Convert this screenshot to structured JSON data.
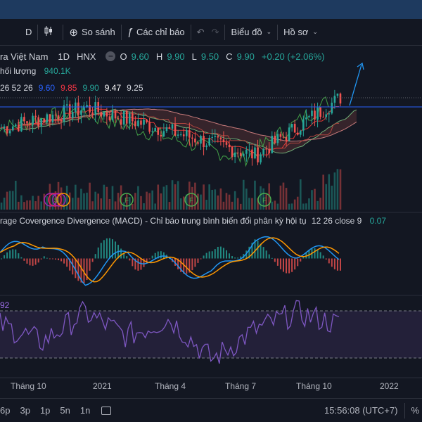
{
  "toolbar": {
    "interval": "D",
    "compare_label": "So sánh",
    "indicators_label": "Các chỉ báo",
    "chart_type_label": "Biểu đồ",
    "profile_label": "Hồ sơ"
  },
  "symbol": {
    "name": "ra Việt Nam",
    "interval": "1D",
    "exchange": "HNX",
    "o_label": "O",
    "o_value": "9.60",
    "h_label": "H",
    "h_value": "9.90",
    "l_label": "L",
    "l_value": "9.50",
    "c_label": "C",
    "c_value": "9.90",
    "change": "+0.20 (+2.06%)"
  },
  "volume": {
    "label": "hối lượng",
    "value": "940.1K"
  },
  "indicator_values": [
    {
      "text": "26 52 26",
      "color": "#d1d4dc"
    },
    {
      "text": "9.60",
      "color": "#2962ff"
    },
    {
      "text": "9.85",
      "color": "#f23645"
    },
    {
      "text": "9.90",
      "color": "#26a69a"
    },
    {
      "text": "9.47",
      "color": "#ffffff"
    },
    {
      "text": "9.25",
      "color": "#d1d4dc"
    }
  ],
  "macd": {
    "title": "rage Covergence Divergence (MACD) - Chỉ báo trung bình biến đổi phân kỳ hội tụ",
    "params": "12 26 close 9",
    "value": "0.07"
  },
  "rsi": {
    "value": "92"
  },
  "time_axis": [
    {
      "label": "Tháng 10",
      "x": 15
    },
    {
      "label": "2021",
      "x": 132
    },
    {
      "label": "Tháng 4",
      "x": 220
    },
    {
      "label": "Tháng 7",
      "x": 320
    },
    {
      "label": "Tháng 10",
      "x": 421
    },
    {
      "label": "2022",
      "x": 540
    }
  ],
  "bottombar": {
    "ranges": [
      "6p",
      "3p",
      "1p",
      "5n",
      "1n"
    ],
    "clock": "15:56:08 (UTC+7)"
  },
  "colors": {
    "background": "#131722",
    "up": "#26a69a",
    "down": "#ef5350",
    "macd_line": "#2196f3",
    "signal_line": "#ff9800",
    "rsi_line": "#7e57c2",
    "price_line": "#2962ff"
  },
  "chart_data": [
    {
      "type": "line",
      "title": "",
      "x": [
        "Tháng 10",
        "2021",
        "Tháng 4",
        "Tháng 7",
        "Tháng 10"
      ],
      "series": [
        {
          "name": "",
          "values": [
            9.0,
            9.6,
            8.9,
            8.2,
            9.9
          ]
        }
      ],
      "last_price": 9.9
    },
    {
      "type": "line",
      "series": [
        {
          "name": "",
          "values": [
            0.1,
            0.3,
            -0.35,
            0.1,
            -0.1,
            -0.3,
            0.3,
            0.12,
            0.07
          ]
        }
      ]
    },
    {
      "type": "line",
      "series": [
        {
          "name": "",
          "values": [
            60,
            45,
            70,
            50,
            65,
            30,
            55,
            70,
            60
          ]
        }
      ]
    }
  ]
}
